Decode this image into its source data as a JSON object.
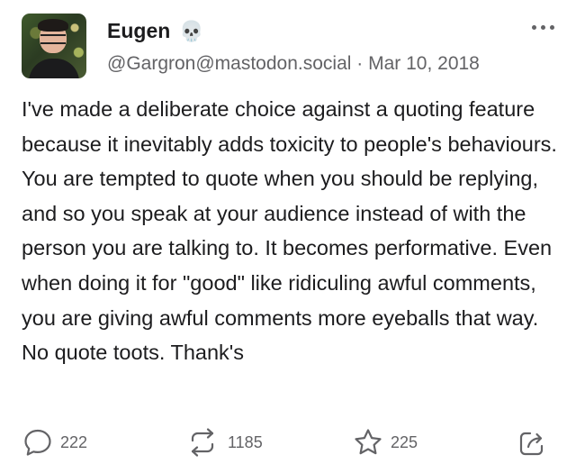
{
  "post": {
    "author_name": "Eugen",
    "name_emoji": "💀",
    "handle": "@Gargron@mastodon.social",
    "separator": "·",
    "date": "Mar 10, 2018",
    "content": "I've made a deliberate choice against a quoting feature because it inevitably adds toxicity to people's behaviours. You are tempted to quote when you should be replying, and so you speak at your audience instead of with the person you are talking to. It becomes performative. Even when doing it for \"good\" like ridiculing awful comments, you are giving awful comments more eyeballs that way. No quote toots. Thank's"
  },
  "actions": {
    "replies": "222",
    "boosts": "1185",
    "favourites": "225"
  },
  "icons": {
    "reply": "speech-bubble-icon",
    "boost": "repeat-icon",
    "favourite": "star-icon",
    "share": "share-icon",
    "more": "ellipsis-icon"
  },
  "colors": {
    "text": "#1c1c1e",
    "muted": "#636366",
    "background": "#ffffff"
  }
}
